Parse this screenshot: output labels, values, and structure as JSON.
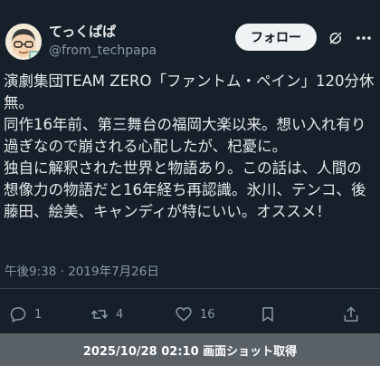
{
  "user": {
    "display_name": "てっくぱぱ",
    "handle": "@from_techpapa",
    "avatar_icon": "cartoon-avatar-icon"
  },
  "header": {
    "follow_label": "フォロー",
    "grok_icon": "grok-icon",
    "more_icon": "more-icon"
  },
  "tweet": {
    "text": "演劇集団TEAM ZERO「ファントム・ペイン」120分休無。\n同作16年前、第三舞台の福岡大楽以来。想い入れ有り過ぎなので崩される心配したが、杞憂に。\n独自に解釈された世界と物語あり。この話は、人間の想像力の物語だと16年経ち再認識。氷川、テンコ、後藤田、絵美、キャンディが特にいい。オススメ！",
    "time": "午後9:38",
    "separator": "·",
    "date": "2019年7月26日"
  },
  "actions": {
    "reply_count": "1",
    "retweet_count": "4",
    "like_count": "16"
  },
  "footer": {
    "caption": "2025/10/28 02:10 画面ショット取得"
  },
  "colors": {
    "background": "#15202b",
    "text_primary": "#e7e9ea",
    "text_secondary": "#8b98a5",
    "footer_bg": "#596066"
  }
}
